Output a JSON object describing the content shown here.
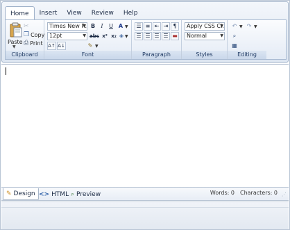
{
  "ribbon": {
    "tabs": [
      {
        "label": "Home",
        "active": true
      },
      {
        "label": "Insert",
        "active": false
      },
      {
        "label": "View",
        "active": false
      },
      {
        "label": "Review",
        "active": false
      },
      {
        "label": "Help",
        "active": false
      }
    ],
    "groups": {
      "clipboard": {
        "label": "Clipboard",
        "paste_label": "Paste",
        "copy_label": "Copy",
        "print_label": "Print"
      },
      "font": {
        "label": "Font",
        "font_name": "Times New R...",
        "font_size": "12pt",
        "bold": "B",
        "italic": "I",
        "underline": "U",
        "strike": "abc",
        "superscript": "x²",
        "subscript": "x₂"
      },
      "paragraph": {
        "label": "Paragraph"
      },
      "styles": {
        "label": "Styles",
        "css_class": "Apply CSS Cl...",
        "paragraph_style": "Normal"
      },
      "editing": {
        "label": "Editing"
      }
    }
  },
  "modes": {
    "design": "Design",
    "html": "HTML",
    "preview": "Preview",
    "active": "design"
  },
  "status": {
    "words_label": "Words:",
    "words": "0",
    "characters_label": "Characters:",
    "characters": "0"
  },
  "colors": {
    "ribbon_border": "#9fb1c9",
    "group_label_bg": "#c9d7ea",
    "accent_blue": "#1f3a63"
  }
}
